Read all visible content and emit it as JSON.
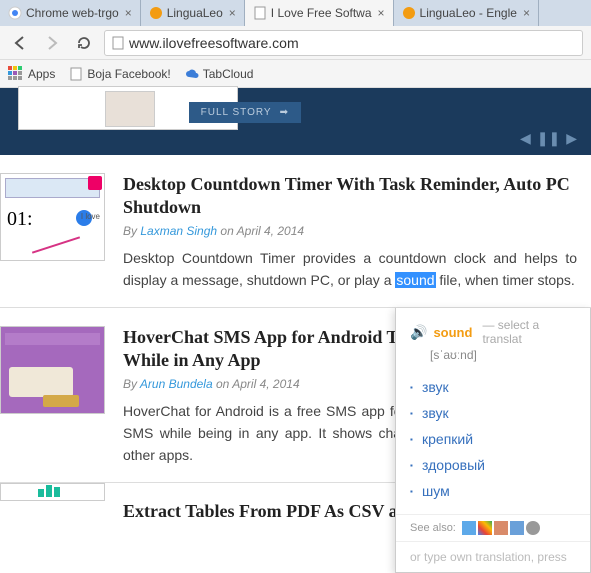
{
  "tabs": [
    {
      "title": "Chrome web-trgo",
      "favicon": "chrome"
    },
    {
      "title": "LinguaLeo",
      "favicon": "lingualeo"
    },
    {
      "title": "I Love Free Softwa",
      "favicon": "page",
      "active": true
    },
    {
      "title": "LinguaLeo - Engle",
      "favicon": "lingualeo"
    }
  ],
  "url": "www.ilovefreesoftware.com",
  "bookmarks": {
    "apps": "Apps",
    "boja": "Boja Facebook!",
    "tabcloud": "TabCloud"
  },
  "hero": {
    "full_story": "FULL STORY"
  },
  "articles": [
    {
      "title": "Desktop Countdown Timer With Task Reminder, Auto PC Shutdown",
      "by": "By",
      "author": "Laxman Singh",
      "on": "on",
      "date": "April 4, 2014",
      "text_before": "Desktop Countdown Timer provides a countdown clock and helps to display a message, shutdown PC, or play a ",
      "highlight": "sound",
      "text_after": " file, when timer stops.",
      "thumb_love": "I love"
    },
    {
      "title": "HoverChat SMS App for Android That Lets You Chat While in Any App",
      "by": "By",
      "author": "Arun Bundela",
      "on": "on",
      "date": "April 4, 2014",
      "text": "HoverChat for Android is a free SMS app for Android that lets you send SMS while being in any app. It shows chat heads that stay on top of other apps."
    }
  ],
  "last_title": "Extract Tables From PDF As CSV and",
  "popup": {
    "word": "sound",
    "hint": "— select a translat",
    "phonetic": "[sˈaʊːnd]",
    "translations": [
      "звук",
      "звук",
      "крепкий",
      "здоровый",
      "шум"
    ],
    "see_also": "See also:",
    "own": "or type own translation, press"
  }
}
